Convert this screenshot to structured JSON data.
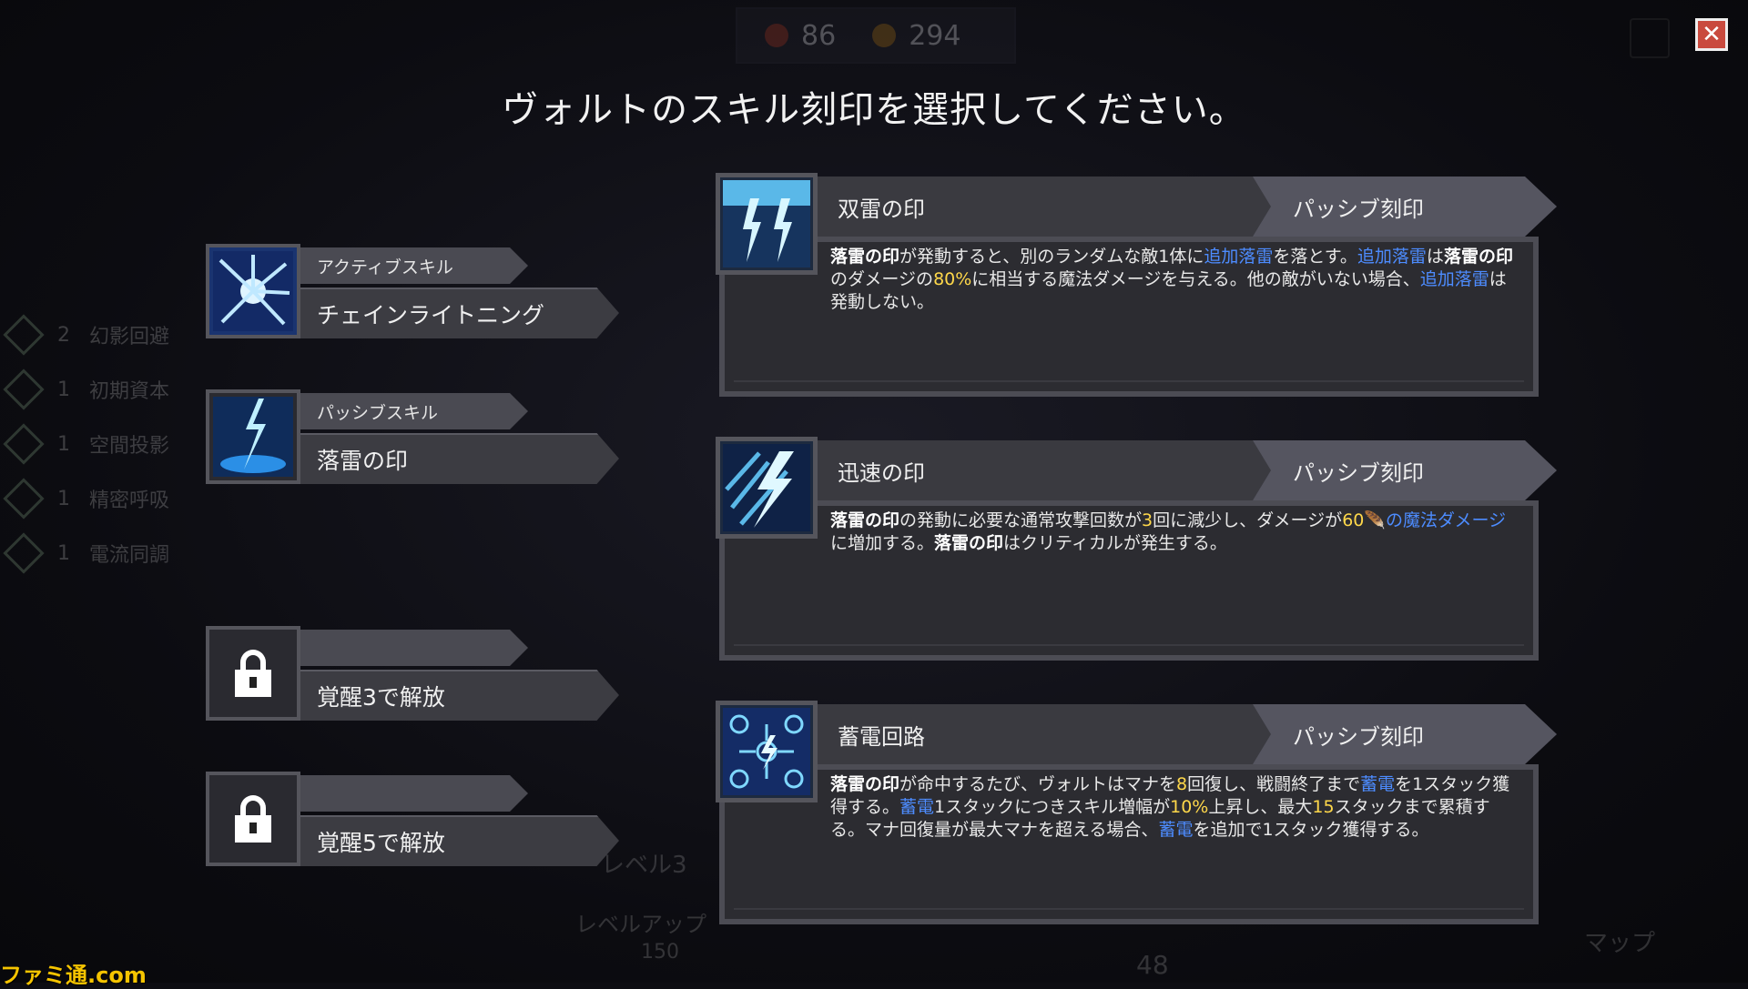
{
  "header": {
    "resources": [
      {
        "icon": "flame-icon",
        "value": "86",
        "color": "#d24a32"
      },
      {
        "icon": "coin-icon",
        "value": "294",
        "color": "#d89a34"
      }
    ],
    "close_label": "✕"
  },
  "title": "ヴォルトのスキル刻印を選択してください。",
  "left_list": [
    {
      "count": "2",
      "label": "幻影回避"
    },
    {
      "count": "1",
      "label": "初期資本"
    },
    {
      "count": "1",
      "label": "空間投影"
    },
    {
      "count": "1",
      "label": "精密呼吸"
    },
    {
      "count": "1",
      "label": "電流同調"
    }
  ],
  "slots": [
    {
      "tag": "アクティブスキル",
      "name": "チェインライトニング",
      "icon": "chain-lightning-icon",
      "locked": false
    },
    {
      "tag": "パッシブスキル",
      "name": "落雷の印",
      "icon": "lightning-strike-icon",
      "locked": false
    },
    {
      "tag": "",
      "name": "覚醒3で解放",
      "icon": "lock-icon",
      "locked": true
    },
    {
      "tag": "",
      "name": "覚醒5で解放",
      "icon": "lock-icon",
      "locked": true
    }
  ],
  "cards": [
    {
      "name": "双雷の印",
      "type": "パッシブ刻印",
      "icon": "twin-lightning-icon",
      "description": [
        {
          "t": "落雷の印",
          "s": "b"
        },
        {
          "t": "が発動すると、別のランダムな敵1体に"
        },
        {
          "t": "追加落雷",
          "s": "blue"
        },
        {
          "t": "を落とす。"
        },
        {
          "t": "追加落雷",
          "s": "blue"
        },
        {
          "t": "は"
        },
        {
          "t": "落雷の印",
          "s": "b"
        },
        {
          "t": "のダメージの"
        },
        {
          "t": "80%",
          "s": "yellow"
        },
        {
          "t": "に相当する魔法ダメージを与える。他の敵がいない場合、"
        },
        {
          "t": "追加落雷",
          "s": "blue"
        },
        {
          "t": "は発動しない。"
        }
      ]
    },
    {
      "name": "迅速の印",
      "type": "パッシブ刻印",
      "icon": "swift-lightning-icon",
      "description": [
        {
          "t": "落雷の印",
          "s": "b"
        },
        {
          "t": "の発動に必要な通常攻撃回数が"
        },
        {
          "t": "3",
          "s": "yellow"
        },
        {
          "t": "回に減少し、ダメージが"
        },
        {
          "t": "60",
          "s": "yellow"
        },
        {
          "t": "🪶",
          "s": "purple"
        },
        {
          "t": "の魔法ダメージ",
          "s": "blue"
        },
        {
          "t": "に増加する。"
        },
        {
          "t": "落雷の印",
          "s": "b"
        },
        {
          "t": "はクリティカルが発生する。"
        }
      ]
    },
    {
      "name": "蓄電回路",
      "type": "パッシブ刻印",
      "icon": "charge-circuit-icon",
      "description": [
        {
          "t": "落雷の印",
          "s": "b"
        },
        {
          "t": "が命中するたび、ヴォルトはマナを"
        },
        {
          "t": "8",
          "s": "yellow"
        },
        {
          "t": "回復し、戦闘終了まで"
        },
        {
          "t": "蓄電",
          "s": "blue"
        },
        {
          "t": "を1スタック獲得する。"
        },
        {
          "t": "蓄電",
          "s": "blue"
        },
        {
          "t": "1スタックにつきスキル増幅が"
        },
        {
          "t": "10%",
          "s": "yellow"
        },
        {
          "t": "上昇し、最大"
        },
        {
          "t": "15",
          "s": "yellow"
        },
        {
          "t": "スタックまで累積する。マナ回復量が最大マナを超える場合、"
        },
        {
          "t": "蓄電",
          "s": "blue"
        },
        {
          "t": "を追加で1スタック獲得する。"
        }
      ]
    }
  ],
  "background_ui": {
    "level_label": "レベル3",
    "levelup_label": "レベルアップ",
    "levelup_cost": "150",
    "bottom_count": "48",
    "map_label": "マップ"
  },
  "watermark": "ファミ通.com",
  "colors": {
    "highlight_blue": "#4d8cff",
    "highlight_yellow": "#ffd84a",
    "close_red": "#c94a3e"
  }
}
